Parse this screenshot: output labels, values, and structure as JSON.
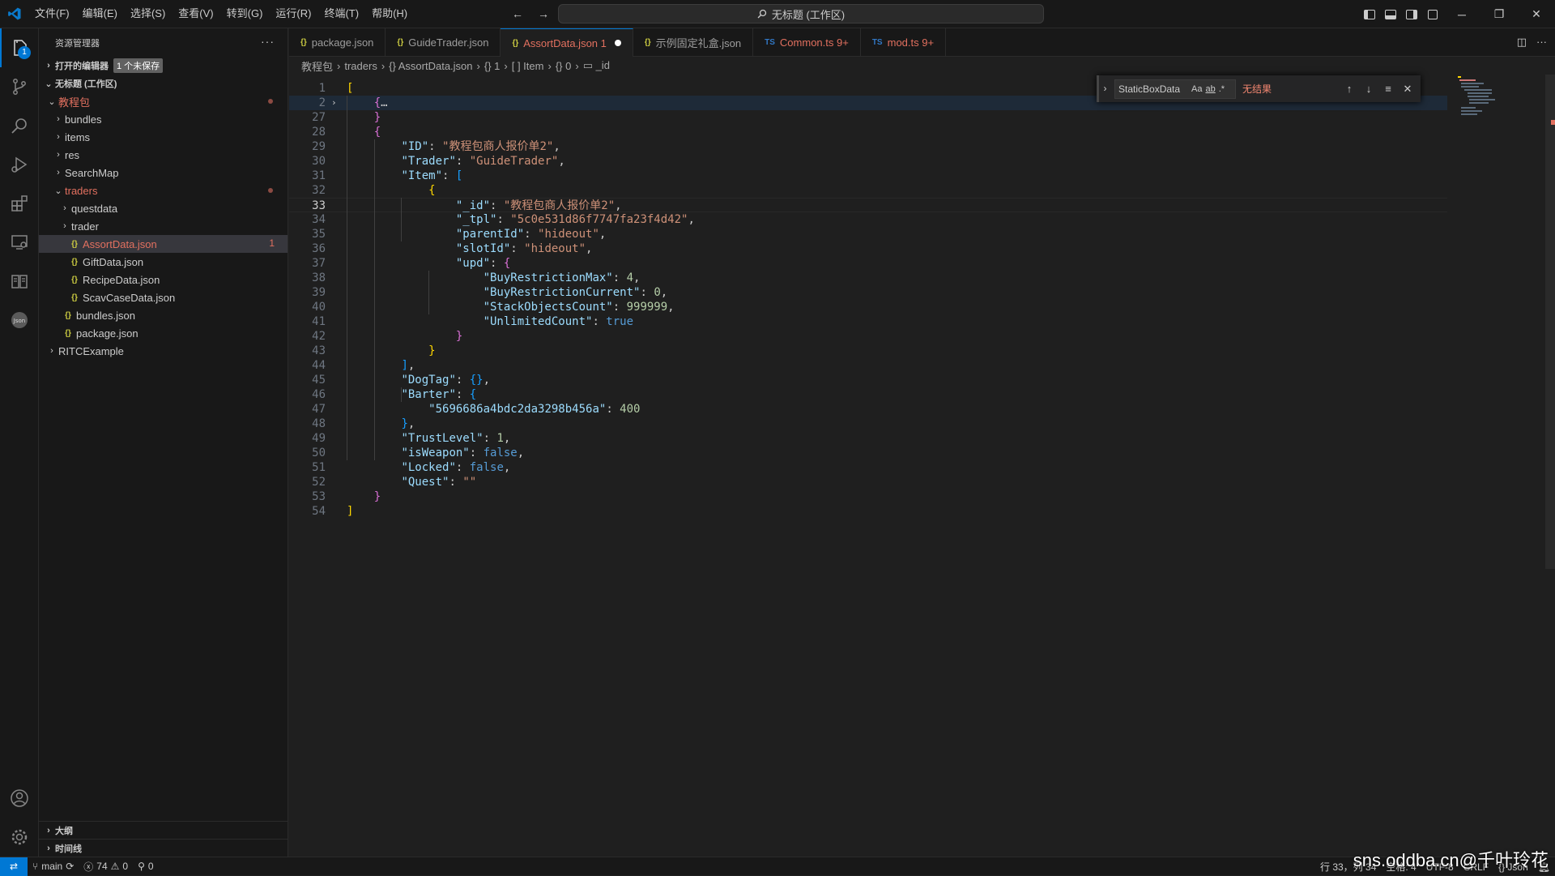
{
  "title_bar": {
    "menus": [
      "文件(F)",
      "编辑(E)",
      "选择(S)",
      "查看(V)",
      "转到(G)",
      "运行(R)",
      "终端(T)",
      "帮助(H)"
    ],
    "command_center": "无标题 (工作区)"
  },
  "sidebar": {
    "title": "资源管理器",
    "open_editors": "打开的编辑器",
    "unsaved_badge": "1 个未保存",
    "workspace": "无标题 (工作区)",
    "tree": [
      {
        "label": "教程包",
        "level": 1,
        "type": "folder-open",
        "modified": true
      },
      {
        "label": "bundles",
        "level": 2,
        "type": "folder"
      },
      {
        "label": "items",
        "level": 2,
        "type": "folder"
      },
      {
        "label": "res",
        "level": 2,
        "type": "folder"
      },
      {
        "label": "SearchMap",
        "level": 2,
        "type": "folder"
      },
      {
        "label": "traders",
        "level": 2,
        "type": "folder-open",
        "modified": true
      },
      {
        "label": "questdata",
        "level": 3,
        "type": "folder"
      },
      {
        "label": "trader",
        "level": 3,
        "type": "folder"
      },
      {
        "label": "AssortData.json",
        "level": 3,
        "type": "json",
        "selected": true,
        "errors": "1"
      },
      {
        "label": "GiftData.json",
        "level": 3,
        "type": "json"
      },
      {
        "label": "RecipeData.json",
        "level": 3,
        "type": "json"
      },
      {
        "label": "ScavCaseData.json",
        "level": 3,
        "type": "json"
      },
      {
        "label": "bundles.json",
        "level": 2,
        "type": "json"
      },
      {
        "label": "package.json",
        "level": 2,
        "type": "json"
      },
      {
        "label": "RITCExample",
        "level": 1,
        "type": "folder"
      }
    ],
    "outline": "大纲",
    "timeline": "时间线"
  },
  "tabs": [
    {
      "label": "package.json",
      "icon": "{}",
      "kind": "json"
    },
    {
      "label": "GuideTrader.json",
      "icon": "{}",
      "kind": "json"
    },
    {
      "label": "AssortData.json 1",
      "icon": "{}",
      "kind": "json",
      "active": true,
      "dirty": true
    },
    {
      "label": "示例固定礼盒.json",
      "icon": "{}",
      "kind": "json"
    },
    {
      "label": "Common.ts 9+",
      "icon": "TS",
      "kind": "ts",
      "error": true
    },
    {
      "label": "mod.ts 9+",
      "icon": "TS",
      "kind": "ts",
      "error": true
    }
  ],
  "breadcrumb": [
    "教程包",
    "traders",
    "{} AssortData.json",
    "{} 1",
    "[ ] Item",
    "{} 0",
    "▭ _id"
  ],
  "find_widget": {
    "value": "StaticBoxData",
    "opt_case": "Aa",
    "opt_word": "ab",
    "opt_regex": ".*",
    "result": "无结果"
  },
  "editor": {
    "current_line": 33,
    "lines": [
      {
        "n": "1",
        "html": "<span class='br1'>[</span>"
      },
      {
        "n": "2",
        "html": "    <span class='br2'>{</span><span class='p'>…</span>",
        "fold": true
      },
      {
        "n": "27",
        "html": "    <span class='br2'>}</span>"
      },
      {
        "n": "28",
        "html": "    <span class='br2'>{</span>"
      },
      {
        "n": "29",
        "html": "        <span class='k'>\"ID\"</span><span class='p'>: </span><span class='s'>\"教程包商人报价单2\"</span><span class='p'>,</span>"
      },
      {
        "n": "30",
        "html": "        <span class='k'>\"Trader\"</span><span class='p'>: </span><span class='s'>\"GuideTrader\"</span><span class='p'>,</span>"
      },
      {
        "n": "31",
        "html": "        <span class='k'>\"Item\"</span><span class='p'>: </span><span class='br3'>[</span>"
      },
      {
        "n": "32",
        "html": "            <span class='br1'>{</span>"
      },
      {
        "n": "33",
        "html": "                <span class='k'>\"_id\"</span><span class='p'>: </span><span class='s'>\"教程包商人报价单2\"</span><span class='p'>,</span>"
      },
      {
        "n": "34",
        "html": "                <span class='k'>\"_tpl\"</span><span class='p'>: </span><span class='s'>\"5c0e531d86f7747fa23f4d42\"</span><span class='p'>,</span>"
      },
      {
        "n": "35",
        "html": "                <span class='k'>\"parentId\"</span><span class='p'>: </span><span class='s'>\"hideout\"</span><span class='p'>,</span>"
      },
      {
        "n": "36",
        "html": "                <span class='k'>\"slotId\"</span><span class='p'>: </span><span class='s'>\"hideout\"</span><span class='p'>,</span>"
      },
      {
        "n": "37",
        "html": "                <span class='k'>\"upd\"</span><span class='p'>: </span><span class='br2'>{</span>"
      },
      {
        "n": "38",
        "html": "                    <span class='k'>\"BuyRestrictionMax\"</span><span class='p'>: </span><span class='n'>4</span><span class='p'>,</span>"
      },
      {
        "n": "39",
        "html": "                    <span class='k'>\"BuyRestrictionCurrent\"</span><span class='p'>: </span><span class='n'>0</span><span class='p'>,</span>"
      },
      {
        "n": "40",
        "html": "                    <span class='k'>\"StackObjectsCount\"</span><span class='p'>: </span><span class='n'>999999</span><span class='p'>,</span>"
      },
      {
        "n": "41",
        "html": "                    <span class='k'>\"UnlimitedCount\"</span><span class='p'>: </span><span class='b'>true</span>"
      },
      {
        "n": "42",
        "html": "                <span class='br2'>}</span>"
      },
      {
        "n": "43",
        "html": "            <span class='br1'>}</span>"
      },
      {
        "n": "44",
        "html": "        <span class='br3'>]</span><span class='p'>,</span>"
      },
      {
        "n": "45",
        "html": "        <span class='k'>\"DogTag\"</span><span class='p'>: </span><span class='br3'>{}</span><span class='p'>,</span>"
      },
      {
        "n": "46",
        "html": "        <span class='k'>\"Barter\"</span><span class='p'>: </span><span class='br3'>{</span>"
      },
      {
        "n": "47",
        "html": "            <span class='k'>\"5696686a4bdc2da3298b456a\"</span><span class='p'>: </span><span class='n'>400</span>"
      },
      {
        "n": "48",
        "html": "        <span class='br3'>}</span><span class='p'>,</span>"
      },
      {
        "n": "49",
        "html": "        <span class='k'>\"TrustLevel\"</span><span class='p'>: </span><span class='n'>1</span><span class='p'>,</span>"
      },
      {
        "n": "50",
        "html": "        <span class='k'>\"isWeapon\"</span><span class='p'>: </span><span class='b'>false</span><span class='p'>,</span>"
      },
      {
        "n": "51",
        "html": "        <span class='k'>\"Locked\"</span><span class='p'>: </span><span class='b'>false</span><span class='p'>,</span>"
      },
      {
        "n": "52",
        "html": "        <span class='k'>\"Quest\"</span><span class='p'>: </span><span class='s'>\"\"</span>"
      },
      {
        "n": "53",
        "html": "    <span class='br2'>}</span>"
      },
      {
        "n": "54",
        "html": "<span class='br1'>]</span>"
      }
    ]
  },
  "status_bar": {
    "branch": "main",
    "errors": "74",
    "warnings": "0",
    "ports": "0",
    "position": "行 33，列 34",
    "spaces": "空格: 4",
    "encoding": "UTF-8",
    "eol": "CRLF",
    "language": "{} Json"
  },
  "watermark": "sns.oddba.cn@千叶玲花"
}
